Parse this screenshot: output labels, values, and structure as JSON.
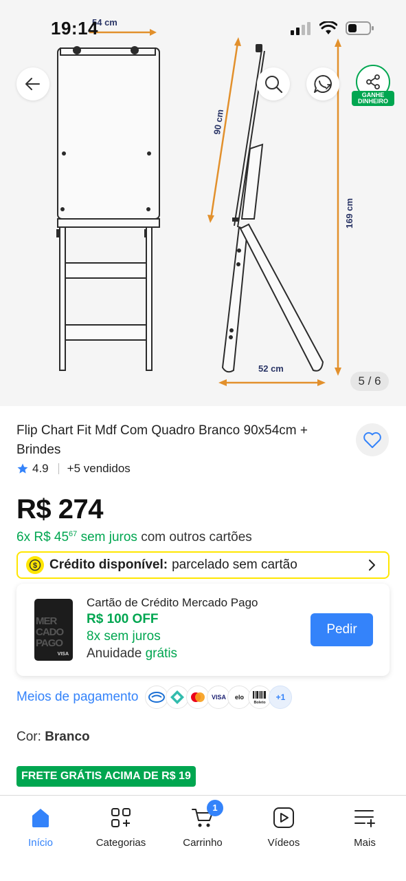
{
  "status_bar": {
    "time": "19:14"
  },
  "gallery": {
    "counter": "5 / 6",
    "dimensions": {
      "width_top": "54 cm",
      "height_board": "90 cm",
      "height_total": "169 cm",
      "width_base": "52 cm"
    },
    "buttons": {
      "back": "arrow-left-icon",
      "search": "search-icon",
      "whatsapp": "whatsapp-icon",
      "share": "share-icon"
    },
    "share_badge": "GANHE DINHEIRO"
  },
  "product": {
    "title": "Flip Chart Fit Mdf Com Quadro Branco 90x54cm + Brindes",
    "rating": "4.9",
    "sold": "+5 vendidos",
    "price": "R$ 274",
    "installments": {
      "count": "6x R$ 45",
      "cents": "67",
      "terms": " sem juros",
      "suffix": " com outros cartões"
    }
  },
  "credit": {
    "label": "Crédito disponível:",
    "text": "parcelado sem cartão"
  },
  "mp_card": {
    "title": "Cartão de Crédito Mercado Pago",
    "discount": "R$ 100 OFF",
    "installments": "8x sem juros",
    "annuity_prefix": "Anuidade ",
    "annuity_value": "grátis",
    "card_text": [
      "MER",
      "CADO",
      "PAGO"
    ],
    "card_brand": "VISA",
    "button": "Pedir"
  },
  "payments": {
    "label": "Meios de pagamento",
    "methods": [
      "mercado-pago",
      "pix",
      "mastercard",
      "VISA",
      "elo",
      "Boleto"
    ],
    "more": "+1"
  },
  "color": {
    "label": "Cor: ",
    "value": "Branco"
  },
  "shipping_badge": "FRETE GRÁTIS ACIMA DE R$ 19",
  "nav": {
    "items": [
      {
        "label": "Início",
        "icon": "home-icon",
        "active": true
      },
      {
        "label": "Categorias",
        "icon": "categories-icon",
        "active": false
      },
      {
        "label": "Carrinho",
        "icon": "cart-icon",
        "active": false,
        "badge": "1"
      },
      {
        "label": "Vídeos",
        "icon": "video-icon",
        "active": false
      },
      {
        "label": "Mais",
        "icon": "menu-icon",
        "active": false
      }
    ]
  },
  "colors": {
    "accent": "#3483fa",
    "green": "#00a650",
    "yellow": "#ffe600",
    "dimension": "#e2902c"
  }
}
